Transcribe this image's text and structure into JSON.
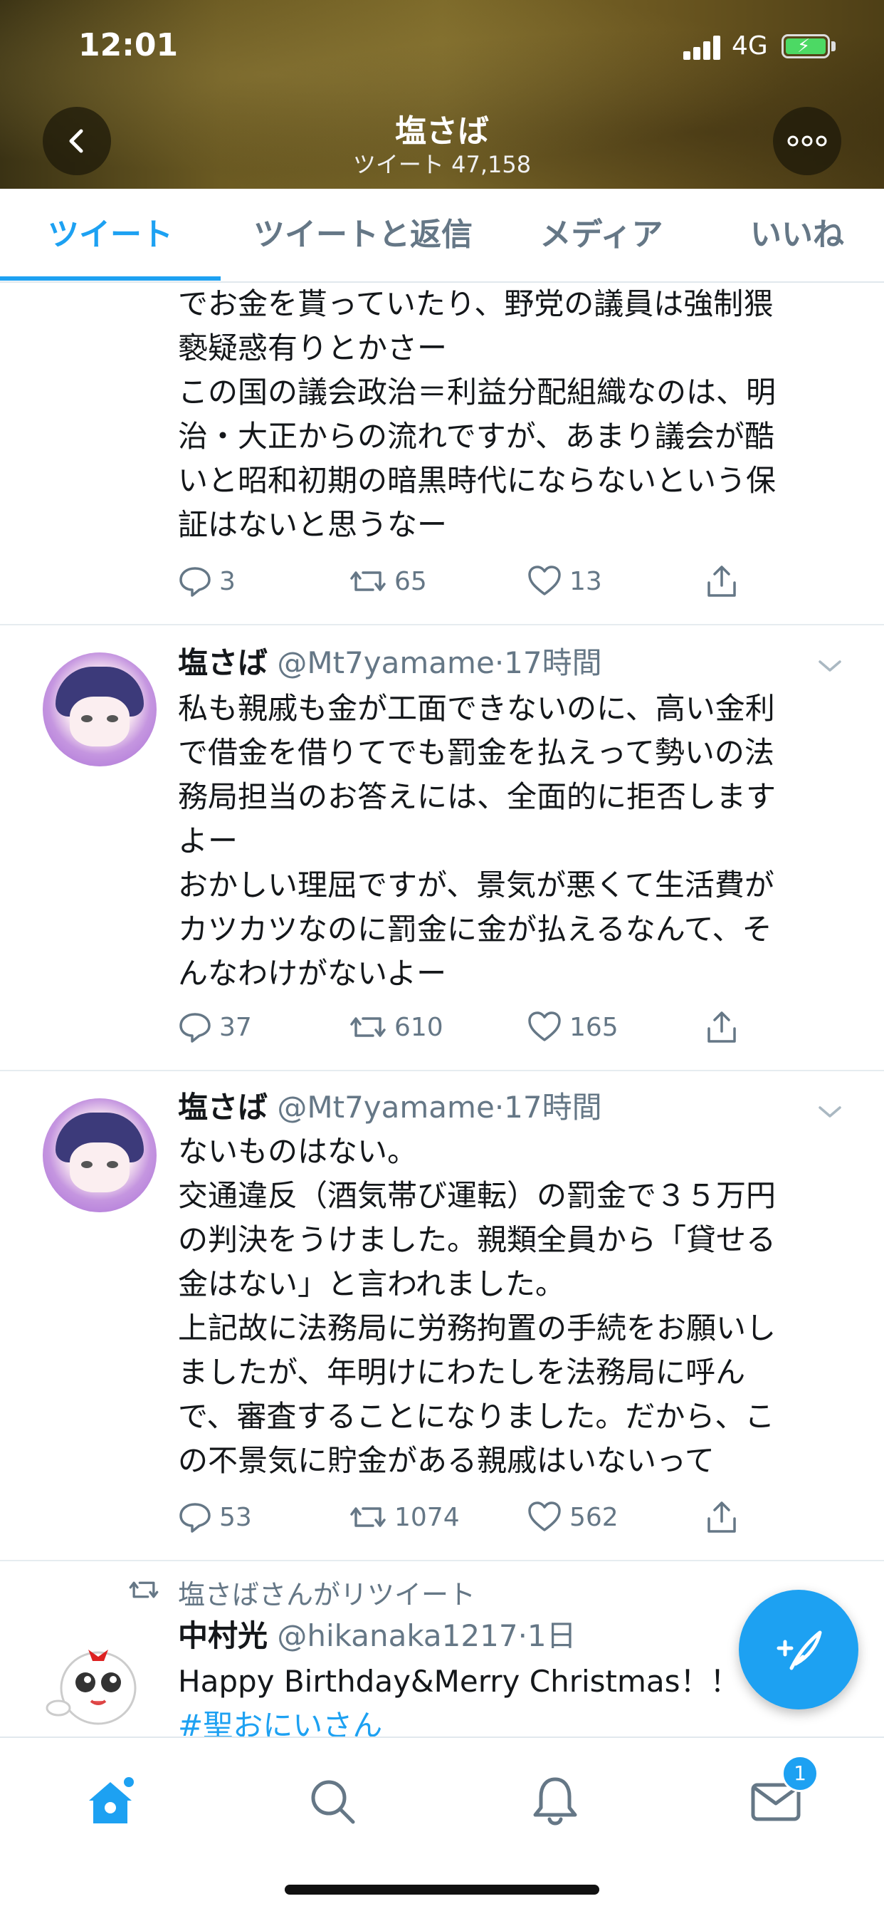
{
  "status_bar": {
    "time": "12:01",
    "network": "4G"
  },
  "header": {
    "title": "塩さば",
    "subtitle": "ツイート 47,158"
  },
  "tabs": [
    {
      "label": "ツイート",
      "active": true
    },
    {
      "label": "ツイートと返信",
      "active": false
    },
    {
      "label": "メディア",
      "active": false
    },
    {
      "label": "いいね",
      "active": false
    }
  ],
  "tweets": [
    {
      "text": "でお金を貰っていたり、野党の議員は強制猥\n褻疑惑有りとかさー\nこの国の議会政治＝利益分配組織なのは、明\n治・大正からの流れですが、あまり議会が酷\nいと昭和初期の暗黒時代にならないという保\n証はないと思うなー",
      "replies": "3",
      "retweets": "65",
      "likes": "13"
    },
    {
      "name": "塩さば",
      "handle": "@Mt7yamame",
      "time": "·17時間",
      "text": "私も親戚も金が工面できないのに、高い金利\nで借金を借りてでも罰金を払えって勢いの法\n務局担当のお答えには、全面的に拒否します\nよー\nおかしい理屈ですが、景気が悪くて生活費が\nカツカツなのに罰金に金が払えるなんて、そ\nんなわけがないよー",
      "replies": "37",
      "retweets": "610",
      "likes": "165"
    },
    {
      "name": "塩さば",
      "handle": "@Mt7yamame",
      "time": "·17時間",
      "text": "ないものはない。\n交通違反（酒気帯び運転）の罰金で３５万円\nの判決をうけました。親類全員から「貸せる\n金はない」と言われました。\n上記故に法務局に労務拘置の手続をお願いし\nましたが、年明けにわたしを法務局に呼ん\nで、審査することになりました。だから、こ\nの不景気に貯金がある親戚はいないって",
      "replies": "53",
      "retweets": "1074",
      "likes": "562"
    },
    {
      "retweet_note": "塩さばさんがリツイート",
      "name": "中村光",
      "handle": "@hikanaka1217",
      "time": "·1日",
      "text": "Happy Birthday&Merry Christmas！！",
      "hashtag": "#聖おにいさん"
    }
  ],
  "bottom_nav": {
    "messages_badge": "1"
  },
  "colors": {
    "accent": "#1da1f2",
    "text": "#14171a",
    "muted": "#657786"
  }
}
